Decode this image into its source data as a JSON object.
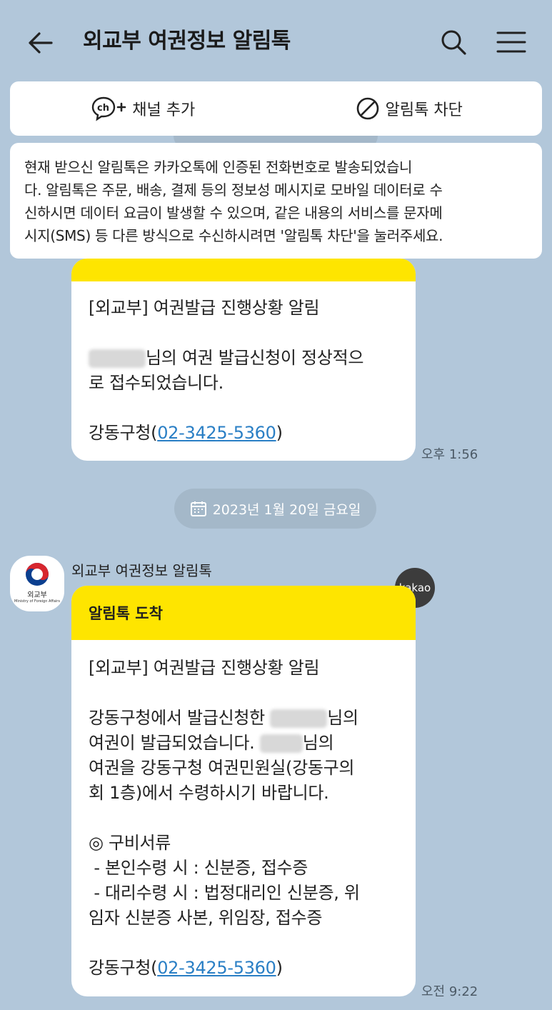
{
  "header": {
    "title": "외교부 여권정보 알림톡",
    "back_icon": "arrow-left-icon",
    "search_icon": "search-icon",
    "menu_icon": "hamburger-menu-icon"
  },
  "actions": {
    "add_channel_label": "채널 추가",
    "block_label": "알림톡 차단"
  },
  "notice": {
    "lines": [
      "현재 받으신 알림톡은 카카오톡에 인증된 전화번호로 발송되었습니",
      "다. 알림톡은 주문, 배송, 결제 등의 정보성 메시지로 모바일 데이터로 수",
      "신하시면 데이터 요금이 발생할 수 있으며, 같은 내용의 서비스를 문자메",
      "시지(SMS) 등 다른 방식으로 수신하시려면 '알림톡 차단'을 눌러주세요."
    ]
  },
  "message1": {
    "lines": [
      "[외교부] 여권발급 진행상황 알림",
      "",
      "님의 여권 발급신청이 정상적으",
      "로 접수되었습니다.",
      "",
      "강동구청("
    ],
    "phone": "02-3425-5360",
    "close": ")",
    "time": "오후 1:56"
  },
  "date_divider": "2023년 1월 20일 금요일",
  "sender": {
    "name": "외교부 여권정보 알림톡",
    "avatar_org": "외교부",
    "avatar_org_en": "Ministry of Foreign Affairs",
    "badge": "kakao"
  },
  "message2": {
    "header": "알림톡 도착",
    "title": "[외교부] 여권발급 진행상황 알림",
    "line1_prefix": "강동구청에서 발급신청한 ",
    "line1_suffix": "님의",
    "line2_prefix": "여권이 발급되었습니다. ",
    "line2_suffix": "님의",
    "line3": "여권을 강동구청 여권민원실(강동구의",
    "line4": "회 1층)에서 수령하시기 바랍니다.",
    "docs_title": "◎ 구비서류",
    "doc1": " - 본인수령 시 : 신분증, 접수증",
    "doc2": " - 대리수령 시 : 법정대리인 신분증, 위",
    "doc3": "임자 신분증 사본, 위임장, 접수증",
    "contact_prefix": "강동구청(",
    "phone": "02-3425-5360",
    "close": ")",
    "time": "오전 9:22"
  },
  "colors": {
    "background": "#b2c7da",
    "kakao_yellow": "#fee500",
    "link": "#2a7fc5"
  }
}
